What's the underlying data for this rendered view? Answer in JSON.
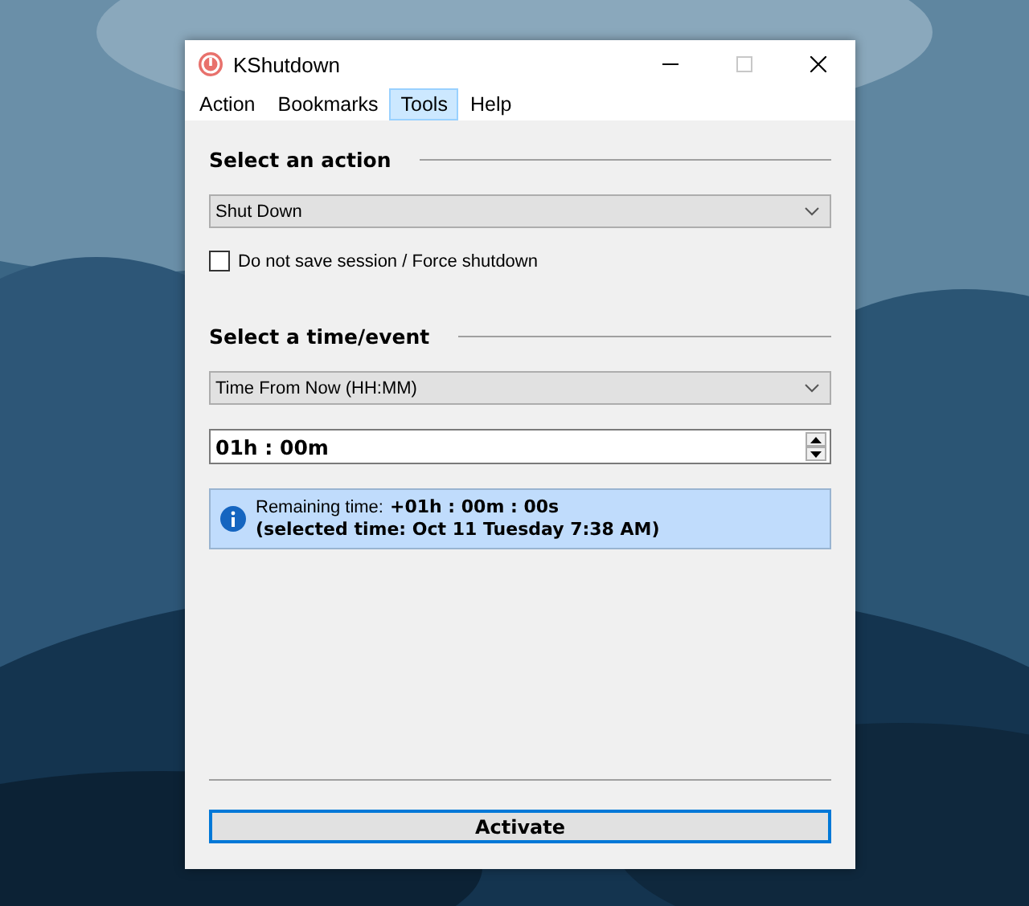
{
  "window": {
    "title": "KShutdown"
  },
  "menu": [
    {
      "label": "Action",
      "selected": false
    },
    {
      "label": "Bookmarks",
      "selected": false
    },
    {
      "label": "Tools",
      "selected": true
    },
    {
      "label": "Help",
      "selected": false
    }
  ],
  "action_section": {
    "title": "Select an action",
    "dropdown": "Shut Down",
    "checkbox": {
      "label": "Do not save session / Force shutdown",
      "checked": false
    }
  },
  "time_section": {
    "title": "Select a time/event",
    "dropdown": "Time From Now (HH:MM)",
    "time_value": "01h : 00m"
  },
  "info": {
    "label": "Remaining time:",
    "remaining": "+01h : 00m : 00s",
    "selected_time": "(selected time: Oct 11 Tuesday 7:38 AM)"
  },
  "activate_button": "Activate"
}
